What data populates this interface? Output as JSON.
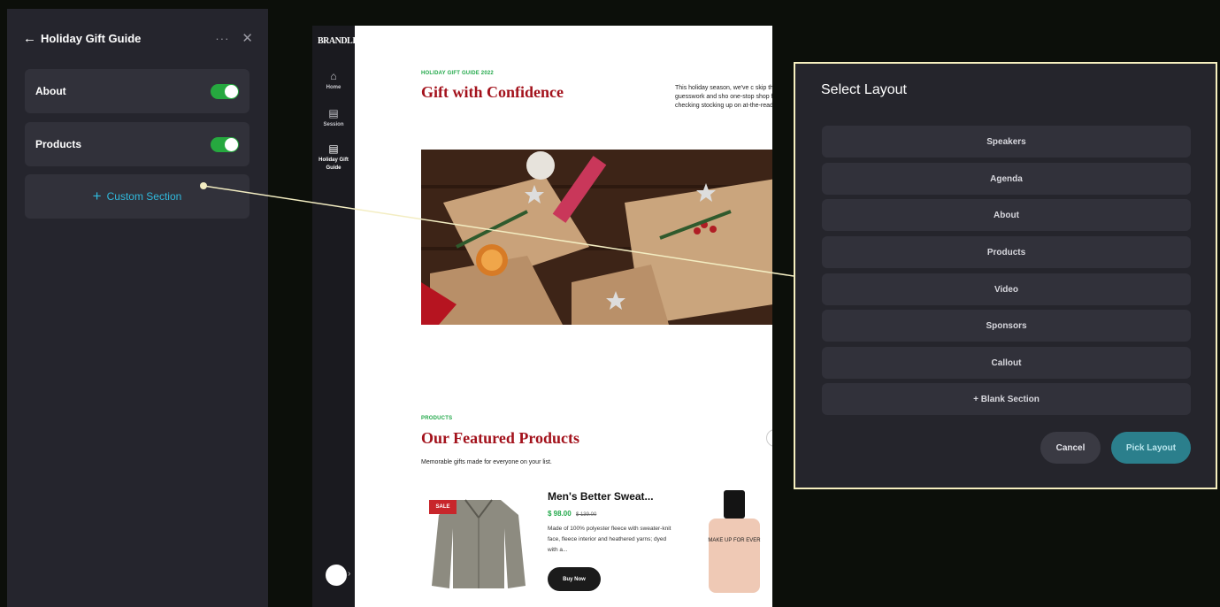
{
  "panel": {
    "title": "Holiday Gift Guide",
    "more_icon": "ellipsis-icon",
    "close_icon": "close-icon",
    "sections": [
      {
        "label": "About",
        "enabled": true
      },
      {
        "label": "Products",
        "enabled": true
      }
    ],
    "custom_section_label": "Custom Section"
  },
  "preview": {
    "logo": "BRANDLIVE",
    "nav": [
      {
        "label": "Home",
        "icon": "home-icon"
      },
      {
        "label": "Session",
        "icon": "calendar-icon"
      },
      {
        "label": "Holiday Gift Guide",
        "icon": "document-icon"
      }
    ],
    "hero": {
      "eyebrow": "HOLIDAY GIFT GUIDE 2022",
      "title": "Gift with Confidence",
      "intro": "This holiday season, we've c skip the guesswork and sho one-stop shop for checking stocking up on at-the-read"
    },
    "products": {
      "eyebrow": "PRODUCTS",
      "title": "Our Featured Products",
      "description": "Memorable gifts made for everyone on your list.",
      "badge": "SALE",
      "name": "Men's Better Sweat...",
      "price": "$ 98.00",
      "old_price": "$ 139.00",
      "text": "Made of 100% polyester fleece with sweater-knit face, fleece interior and heathered yarns; dyed with a...",
      "buy_label": "Buy Now",
      "bottle_text": "MAKE UP FOR EVER"
    }
  },
  "modal": {
    "title": "Select Layout",
    "options": [
      "Speakers",
      "Agenda",
      "About",
      "Products",
      "Video",
      "Sponsors",
      "Callout",
      "+ Blank Section"
    ],
    "cancel_label": "Cancel",
    "pick_label": "Pick Layout"
  },
  "colors": {
    "toggle_on": "#26a83f",
    "accent_link": "#31b9dc",
    "title_red": "#a3121c",
    "eyebrow_green": "#22a84a",
    "pick_button": "#2b7f8c",
    "highlight_border": "#f6efbf"
  }
}
